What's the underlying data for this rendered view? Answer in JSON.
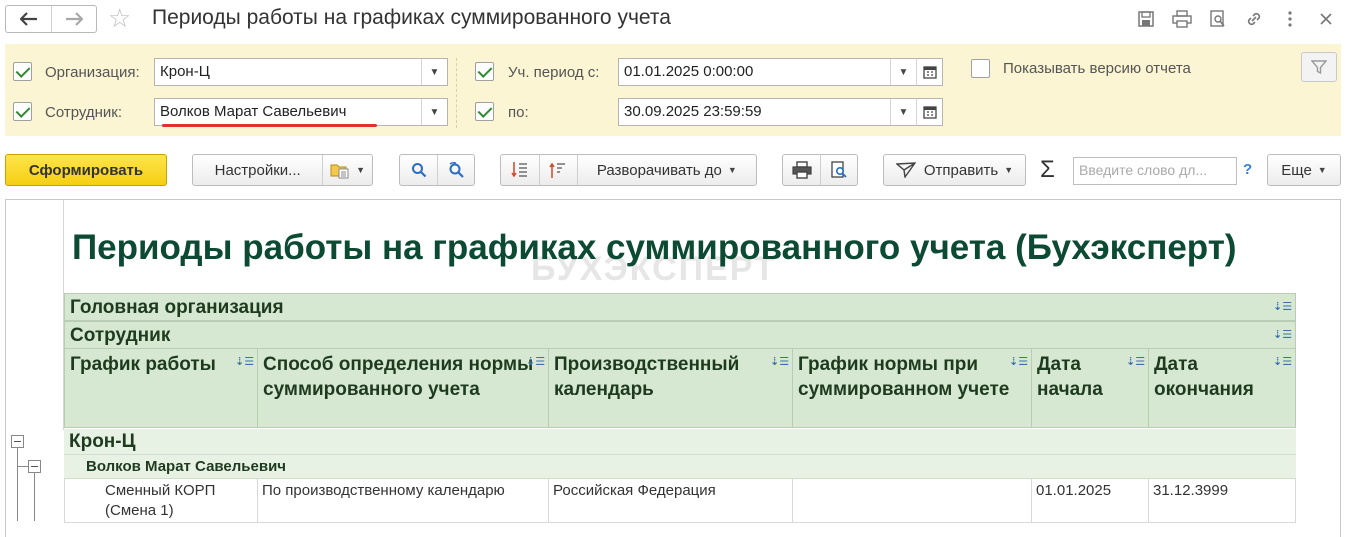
{
  "window": {
    "title": "Периоды работы на графиках суммированного учета"
  },
  "filters": {
    "organization": {
      "label": "Организация:",
      "value": "Крон-Ц",
      "checked": true
    },
    "employee": {
      "label": "Сотрудник:",
      "value": "Волков Марат Савельевич",
      "checked": true
    },
    "period_from": {
      "label": "Уч. период с:",
      "value": "01.01.2025  0:00:00",
      "checked": true
    },
    "period_to": {
      "label": "по:",
      "value": "30.09.2025 23:59:59",
      "checked": true
    },
    "show_version": {
      "label": "Показывать версию отчета",
      "checked": false
    }
  },
  "toolbar": {
    "generate_label": "Сформировать",
    "settings_label": "Настройки...",
    "expand_label": "Разворачивать до",
    "send_label": "Отправить",
    "search_placeholder": "Введите слово дл...",
    "help_label": "?",
    "more_label": "Еще",
    "sigma_label": "Σ"
  },
  "report": {
    "title": "Периоды работы на графиках суммированного учета (Бухэксперт)",
    "watermark": "БУХЭКСПЕРТ",
    "group_headers": [
      "Головная организация",
      "Сотрудник"
    ],
    "columns": [
      "График работы",
      "Способ определения нормы суммированного учета",
      "Производственный календарь",
      "График нормы при суммированном учете",
      "Дата начала",
      "Дата окончания"
    ],
    "group_org": "Крон-Ц",
    "group_employee": "Волков Марат Савельевич",
    "rows": [
      [
        "Сменный КОРП (Смена 1)",
        "По производственному календарю",
        "Российская Федерация",
        "",
        "01.01.2025",
        "31.12.3999"
      ]
    ]
  },
  "colors": {
    "accent_yellow": "#f5cf14",
    "filter_bg": "#fbf5d3",
    "report_title": "#0c4a33",
    "header_bg": "#d6e8d2"
  }
}
